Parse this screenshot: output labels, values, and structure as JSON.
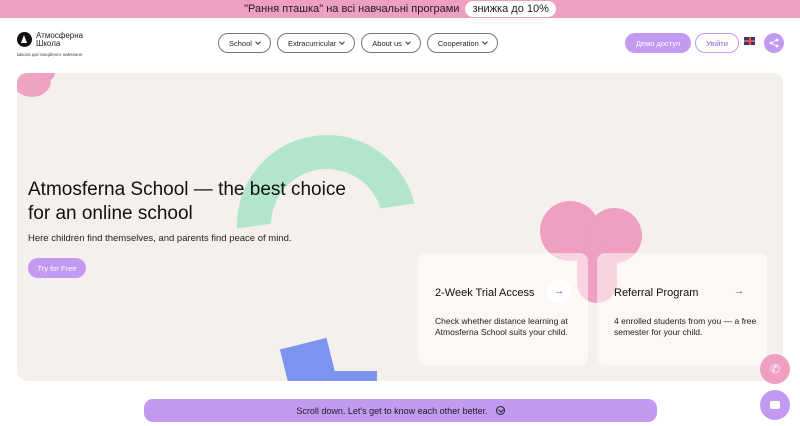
{
  "promo": {
    "text": "\"Рання пташка\" на всі навчальні програми",
    "discount": "знижка до 10%"
  },
  "header": {
    "logo_line1": "Атмосферна",
    "logo_line2": "Школа",
    "logo_tagline": "Школа дистанційного навчання",
    "nav": [
      {
        "label": "School"
      },
      {
        "label": "Extracurricular"
      },
      {
        "label": "About us"
      },
      {
        "label": "Cooperation"
      }
    ],
    "demo_button": "Демо доступ",
    "login_button": "Увійти"
  },
  "hero": {
    "title": "Atmosferna School — the best choice for an online school",
    "subtitle": "Here children find themselves, and parents find peace of mind.",
    "cta": "Try for Free",
    "cards": [
      {
        "title": "2-Week Trial Access",
        "text": "Check whether distance learning at Atmosferna School suits your child."
      },
      {
        "title": "Referral Program",
        "text": "4 enrolled students from you — a free semester for your child."
      }
    ]
  },
  "scroll_banner": "Scroll down. Let's get to know each other better.",
  "icons": {
    "logo": "logo-triangle-icon",
    "nav_chevron": "chevron-down-icon",
    "flag": "uk-flag-icon",
    "share": "share-icon",
    "arrow": "arrow-right-icon",
    "phone": "phone-icon",
    "chat": "chat-icon",
    "scroll": "arrow-down-circle-icon"
  },
  "colors": {
    "promo_bg": "#ef9fc2",
    "accent_purple": "#c39af2",
    "mint": "#b1e6cd",
    "blue": "#7b94f0",
    "hero_bg": "#f5f0ec"
  }
}
